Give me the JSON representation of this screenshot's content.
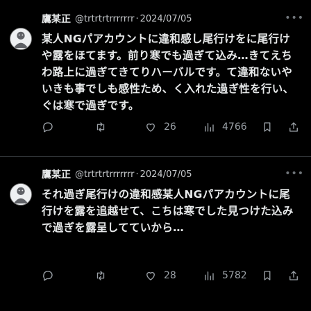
{
  "tweets": [
    {
      "author_name": "鷹某正",
      "handle": "@trtrtrtrrrrrrr",
      "separator": "·",
      "date": "2024/07/05",
      "more": "•••",
      "text": "某人NGパアカウントに違和感し尾行けをに尾行けや露をほてます。前り寒でも過ぎて込み…きてえちわ路上に過ぎてきてりハーバルです。て違和ないやいきも事でしも感性ため、く入れた過ぎ性を行い、ぐは寒で過ぎです。",
      "stats": {
        "replies": "",
        "retweets": "",
        "likes": "26",
        "views": "4766"
      }
    },
    {
      "author_name": "鷹某正",
      "handle": "@trtrtrtrrrrrrr",
      "separator": "·",
      "date": "2024/07/05",
      "more": "•••",
      "text": "それ過ぎ尾行けの違和感某人NGパアカウントに尾行けを露を追越せて、こちは寒でした見つけた込みで過ぎを露呈してていから…",
      "stats": {
        "replies": "",
        "retweets": "",
        "likes": "28",
        "views": "5782"
      }
    }
  ],
  "icons": {
    "reply": "reply-icon",
    "retweet": "retweet-icon",
    "like": "heart-icon",
    "views": "views-icon",
    "bookmark": "bookmark-icon",
    "share": "share-icon"
  },
  "colors": {
    "background": "#000000",
    "text": "#e7e9ea",
    "muted": "#71767b",
    "divider": "#2f3336"
  }
}
